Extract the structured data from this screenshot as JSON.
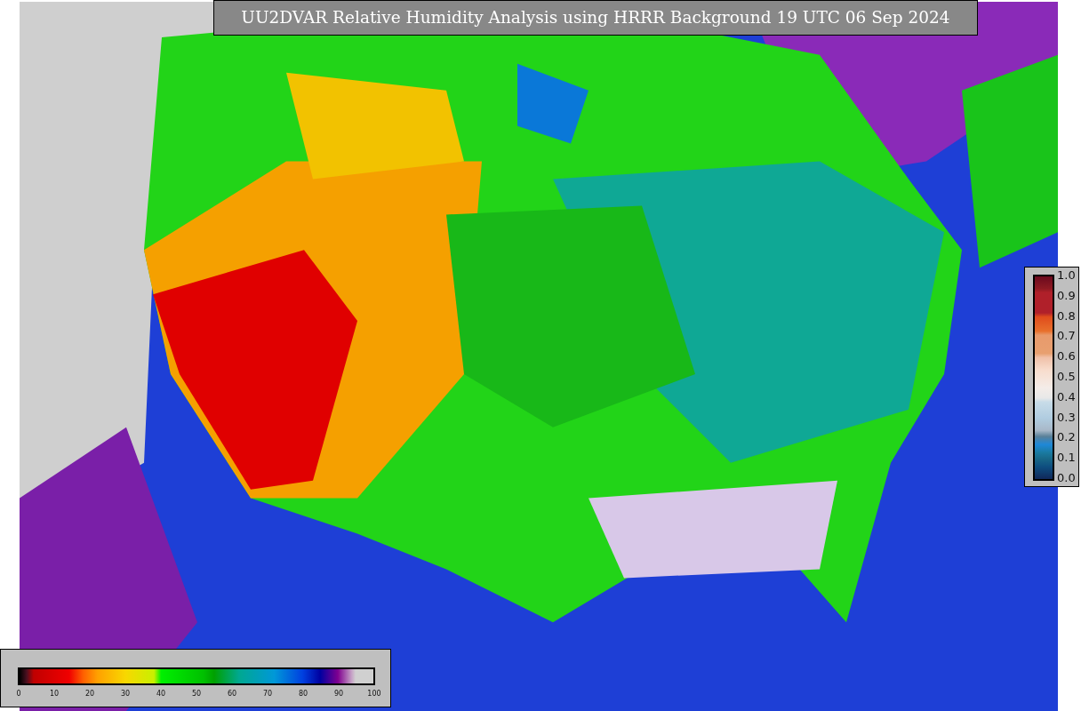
{
  "title": "UU2DVAR Relative Humidity Analysis using HRRR Background 19 UTC 06 Sep 2024",
  "colorbar_bottom": {
    "ticks": [
      "0",
      "10",
      "20",
      "30",
      "40",
      "50",
      "60",
      "70",
      "80",
      "90",
      "100"
    ]
  },
  "colorbar_right": {
    "ticks": [
      "1.0",
      "0.9",
      "0.8",
      "0.7",
      "0.6",
      "0.5",
      "0.4",
      "0.3",
      "0.2",
      "0.1",
      "0.0"
    ]
  }
}
